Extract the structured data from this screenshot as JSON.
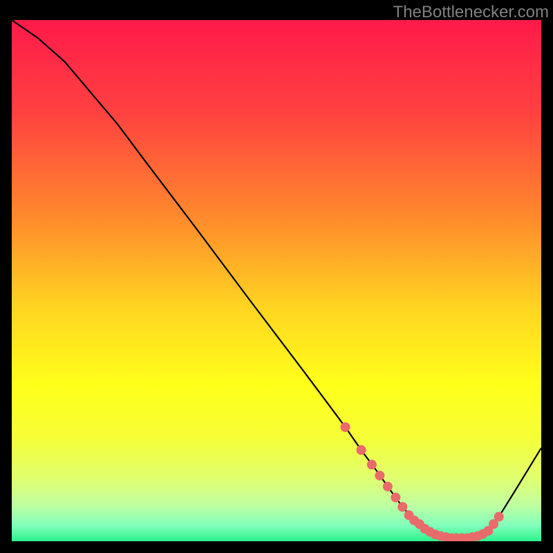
{
  "watermark": "TheBottlenecker.com",
  "chart_data": {
    "type": "line",
    "title": "",
    "xlabel": "",
    "ylabel": "",
    "xlim": [
      0,
      100
    ],
    "ylim": [
      0,
      100
    ],
    "grid": false,
    "background_gradient_stops": [
      {
        "offset": 0.0,
        "color": "#ff1a4a"
      },
      {
        "offset": 0.18,
        "color": "#ff4240"
      },
      {
        "offset": 0.38,
        "color": "#ff8a2c"
      },
      {
        "offset": 0.55,
        "color": "#ffd421"
      },
      {
        "offset": 0.7,
        "color": "#ffff1a"
      },
      {
        "offset": 0.8,
        "color": "#f6ff36"
      },
      {
        "offset": 0.88,
        "color": "#e0ff70"
      },
      {
        "offset": 0.93,
        "color": "#c0ffa0"
      },
      {
        "offset": 0.97,
        "color": "#80ffbc"
      },
      {
        "offset": 1.0,
        "color": "#2cf18c"
      }
    ],
    "series": [
      {
        "name": "bottleneck-curve",
        "color": "#000000",
        "x": [
          0,
          5,
          10,
          15,
          20,
          25,
          30,
          35,
          40,
          45,
          50,
          55,
          60,
          63,
          66,
          69,
          71,
          74,
          77,
          80,
          83,
          86,
          88,
          90,
          92,
          95,
          100
        ],
        "y": [
          100,
          96.5,
          92,
          86,
          80,
          73.2,
          66.5,
          59.8,
          53,
          46.2,
          39.5,
          32.8,
          26,
          21.9,
          17.5,
          13.4,
          10.5,
          6.3,
          3.3,
          1.3,
          0.6,
          0.6,
          1.0,
          2.0,
          4.7,
          9.6,
          17.9
        ]
      }
    ],
    "markers": {
      "name": "highlighted-points",
      "color": "#e96a6a",
      "radius": 7,
      "points": [
        {
          "x": 63.0,
          "y": 21.9
        },
        {
          "x": 66.0,
          "y": 17.5
        },
        {
          "x": 68.0,
          "y": 14.7
        },
        {
          "x": 69.5,
          "y": 12.6
        },
        {
          "x": 71.0,
          "y": 10.5
        },
        {
          "x": 72.5,
          "y": 8.4
        },
        {
          "x": 73.8,
          "y": 6.6
        },
        {
          "x": 75.0,
          "y": 5.0
        },
        {
          "x": 76.0,
          "y": 4.0
        },
        {
          "x": 77.0,
          "y": 3.3
        },
        {
          "x": 78.0,
          "y": 2.4
        },
        {
          "x": 79.0,
          "y": 1.8
        },
        {
          "x": 80.0,
          "y": 1.3
        },
        {
          "x": 81.0,
          "y": 1.0
        },
        {
          "x": 82.0,
          "y": 0.8
        },
        {
          "x": 83.0,
          "y": 0.6
        },
        {
          "x": 84.0,
          "y": 0.6
        },
        {
          "x": 85.0,
          "y": 0.6
        },
        {
          "x": 86.0,
          "y": 0.6
        },
        {
          "x": 87.0,
          "y": 0.8
        },
        {
          "x": 88.0,
          "y": 1.0
        },
        {
          "x": 89.0,
          "y": 1.4
        },
        {
          "x": 90.0,
          "y": 2.0
        },
        {
          "x": 91.0,
          "y": 3.3
        },
        {
          "x": 92.0,
          "y": 4.7
        }
      ]
    }
  }
}
